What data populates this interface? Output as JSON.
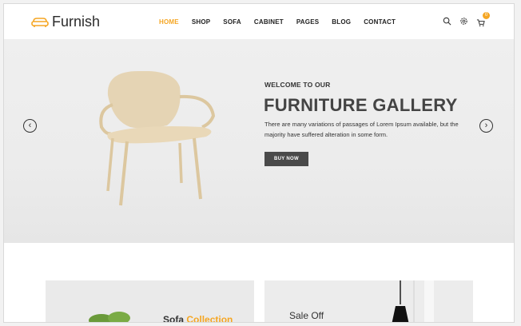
{
  "brand": {
    "name": "Furnish",
    "accent": "#f5a623"
  },
  "nav": {
    "items": [
      "HOME",
      "SHOP",
      "SOFA",
      "CABINET",
      "PAGES",
      "BLOG",
      "CONTACT"
    ],
    "active": "HOME"
  },
  "header_icons": {
    "search": "search-icon",
    "settings": "gear-icon",
    "cart": "cart-icon",
    "cart_count": "0"
  },
  "hero": {
    "kicker": "WELCOME TO OUR",
    "title": "FURNITURE GALLERY",
    "description": "There are many variations of passages of Lorem Ipsum available, but the majority have suffered alteration in some form.",
    "button": "BUY NOW"
  },
  "promos": {
    "sofa": {
      "title_main": "Sofa",
      "title_accent": "Collection"
    },
    "sale": {
      "title": "Sale Off"
    }
  }
}
